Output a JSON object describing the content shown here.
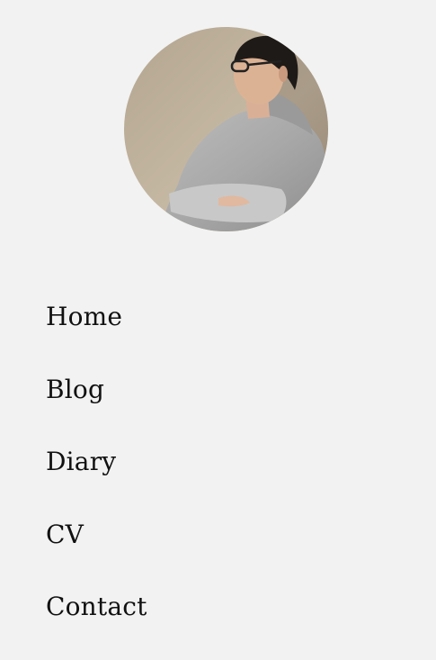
{
  "profile": {
    "avatar_alt": "profile photo"
  },
  "nav": {
    "items": [
      {
        "label": "Home"
      },
      {
        "label": "Blog"
      },
      {
        "label": "Diary"
      },
      {
        "label": "CV"
      },
      {
        "label": "Contact"
      }
    ]
  },
  "colors": {
    "background": "#f2f2f2",
    "text": "#111111"
  }
}
